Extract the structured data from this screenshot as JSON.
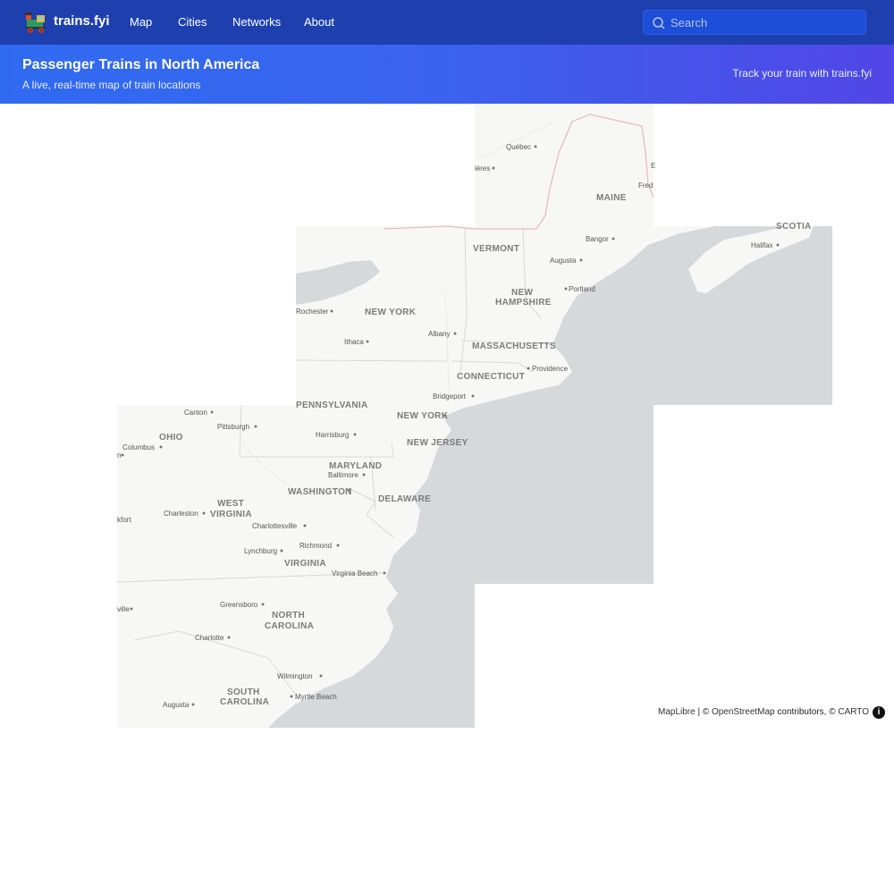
{
  "nav": {
    "brand": "trains.fyi",
    "links": [
      "Map",
      "Cities",
      "Networks",
      "About"
    ],
    "search_placeholder": "Search"
  },
  "banner": {
    "title": "Passenger Trains in North America",
    "subtitle": "A live, real-time map of train locations",
    "cta": "Track your train with trains.fyi"
  },
  "map": {
    "states": [
      "MAINE",
      "VERMONT",
      "NEW YORK",
      "NEW",
      "HAMPSHIRE",
      "MASSACHUSETTS",
      "CONNECTICUT",
      "PENNSYLVANIA",
      "NEW YORK",
      "NEW JERSEY",
      "OHIO",
      "MARYLAND",
      "WASHINGTON",
      "DELAWARE",
      "WEST",
      "VIRGINIA",
      "VIRGINIA",
      "NORTH",
      "CAROLINA",
      "SOUTH",
      "CAROLINA",
      "SCOTIA"
    ],
    "cities": [
      "Québec",
      "ières",
      "Bangor",
      "Augusta",
      "Portland",
      "Halifax",
      "Rochester",
      "Albany",
      "Ithaca",
      "Providence",
      "Bridgeport",
      "Canton",
      "Pittsburgh",
      "Harrisburg",
      "Columbus",
      "Baltimore",
      "Charleston",
      "Charlottesville",
      "Richmond",
      "Lynchburg",
      "Virginia Beach",
      "Greensboro",
      "Charlotte",
      "Wilmington",
      "Myrtle Beach",
      "Augusta",
      "Fred",
      "ville",
      "kfort",
      "n",
      "E"
    ],
    "colors": {
      "land": "#f7f7f6",
      "water": "#d5d9db",
      "border": "#d8d8d8",
      "intl_border": "#e6b8c0"
    }
  },
  "attribution": {
    "maplibre": "MapLibre",
    "sep": " | © ",
    "osm": "OpenStreetMap",
    "contributors": " contributors, © ",
    "carto": "CARTO",
    "info": "i"
  }
}
